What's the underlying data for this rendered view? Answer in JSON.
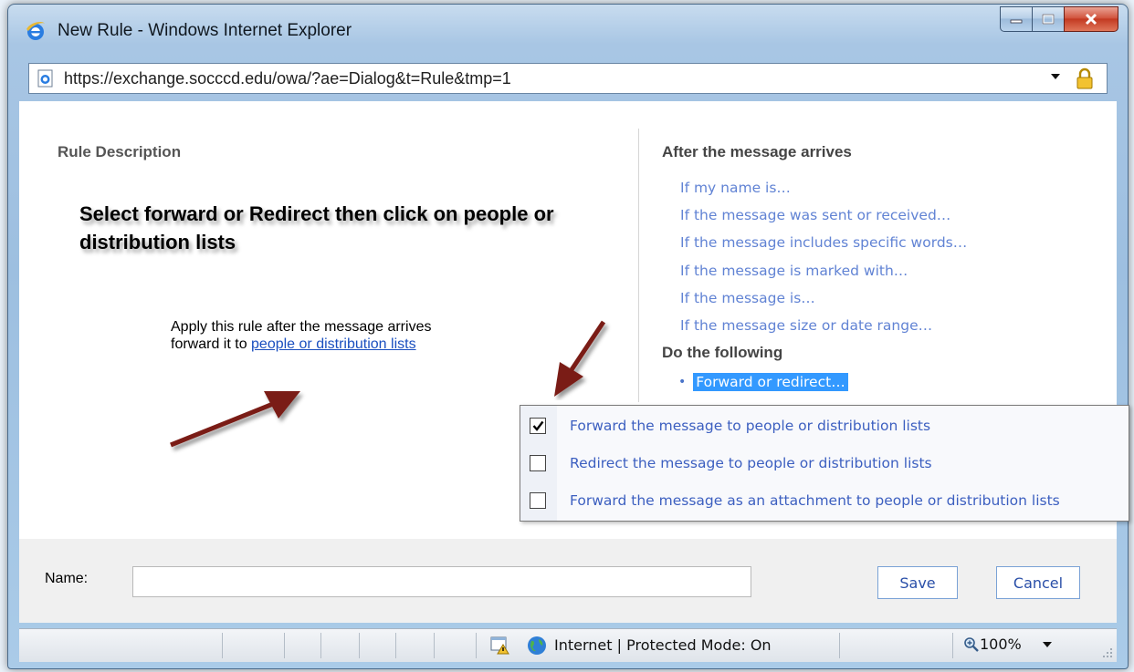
{
  "window": {
    "title": "New Rule - Windows Internet Explorer",
    "url": "https://exchange.socccd.edu/owa/?ae=Dialog&t=Rule&tmp=1"
  },
  "left": {
    "heading": "Rule Description",
    "annotation": "Select forward or Redirect then click on people or distribution lists",
    "rule_line1": "Apply this rule after the message arrives",
    "rule_line2_prefix": "forward it to ",
    "rule_link": "people or distribution lists"
  },
  "right": {
    "conditions_title": "After the message arrives",
    "conditions": [
      "If my name is…",
      "If the message was sent or received…",
      "If the message includes specific words…",
      "If the message is marked with…",
      "If the message is…",
      "If the message size or date range…"
    ],
    "actions_title": "Do the following",
    "selected_action": "Forward or redirect…"
  },
  "popup": {
    "options": [
      {
        "label": "Forward the message to people or distribution lists",
        "checked": true
      },
      {
        "label": "Redirect the message to people or distribution lists",
        "checked": false
      },
      {
        "label": "Forward the message as an attachment to people or distribution lists",
        "checked": false
      }
    ]
  },
  "footer": {
    "name_label": "Name:",
    "name_value": "",
    "save_label": "Save",
    "cancel_label": "Cancel"
  },
  "statusbar": {
    "zone_text": "Internet | Protected Mode: On",
    "zoom": "100%"
  },
  "colors": {
    "link": "#6183d4",
    "selection": "#3399ff",
    "close_button": "#c33a22"
  }
}
